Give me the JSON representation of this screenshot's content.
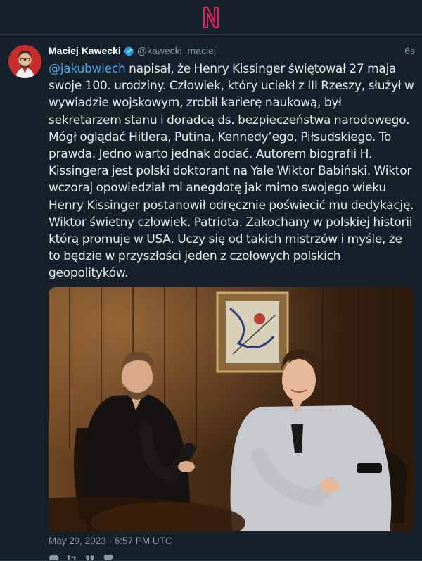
{
  "app": {
    "logo_icon": "app-logo-n-icon",
    "accent_color": "#e0245e",
    "background_color": "#15202b"
  },
  "tweet": {
    "author_name": "Maciej Kawecki",
    "verified_icon": "verified-badge-icon",
    "handle": "@kawecki_maciej",
    "time_ago": "6s",
    "mention": "@jakubwiech",
    "text_after_mention": " napisał, że Henry Kissinger świętował 27 maja swoje 100. urodziny. Człowiek, który uciekł z III Rzeszy, służył w wywiadzie wojskowym, zrobił karierę naukową, był sekretarzem stanu i doradcą ds. bezpieczeństwa narodowego. Mógł oglądać Hitlera, Putina, Kennedy’ego, Piłsudskiego. To prawda. Jedno warto jednak dodać. Autorem biografii H. Kissingera jest polski doktorant na Yale Wiktor Babiński. Wiktor wczoraj opowiedział mi anegdotę jak mimo swojego wieku Henry Kissinger postanowił odręcznie poświecić mu dedykację. Wiktor świetny człowiek. Patriota. Zakochany w polskiej historii którą promuje w USA. Uczy się od takich mistrzów i myśle, że to będzie w przyszłości jeden z czołowych polskich geopolityków.",
    "photo_icon": "tweet-photo-two-men-icon",
    "date": "May 29, 2023 · 6:57 PM UTC",
    "mention_color": "#4aa3e8",
    "actions": [
      {
        "name": "reply",
        "icon": "reply-icon"
      },
      {
        "name": "retweet",
        "icon": "retweet-icon"
      },
      {
        "name": "quote",
        "icon": "quote-icon"
      },
      {
        "name": "like",
        "icon": "heart-icon"
      }
    ]
  }
}
